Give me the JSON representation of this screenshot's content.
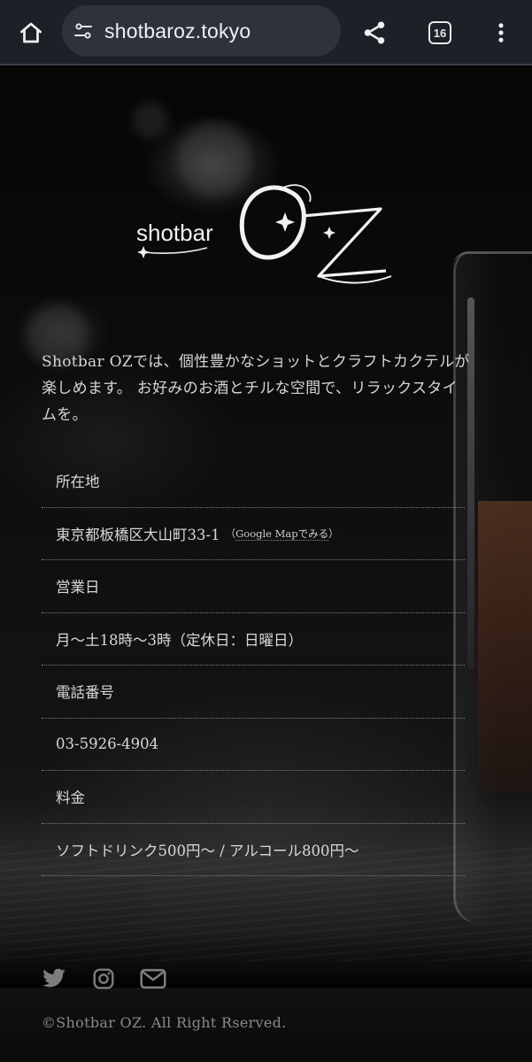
{
  "browser": {
    "url": "shotbaroz.tokyo",
    "tab_count": "16",
    "icons": {
      "home": "home-icon",
      "site_settings": "tune-icon",
      "share": "share-icon",
      "tabs": "tabs-icon",
      "menu": "more-vert-icon"
    }
  },
  "logo": {
    "prefix": "shotbar",
    "name": "OZ"
  },
  "intro": {
    "line1": "Shotbar OZでは、個性豊かなショットとクラフトカクテルが",
    "line2": "楽しめます。 お好みのお酒とチルな空間で、リラックスタイ",
    "line3": "ムを。"
  },
  "info": {
    "location_label": "所在地",
    "address": "東京都板橋区大山町33-1",
    "map_link_open": "（",
    "map_link_label": "Google Mapでみる",
    "map_link_close": "）",
    "hours_label": "営業日",
    "hours": "月〜土18時〜3時（定休日：日曜日）",
    "phone_label": "電話番号",
    "phone": "03-5926-4904",
    "price_label": "料金",
    "price": "ソフトドリンク500円〜 / アルコール800円〜"
  },
  "footer": {
    "social_icons": [
      "twitter-icon",
      "instagram-icon",
      "mail-icon"
    ],
    "copyright": "©Shotbar OZ. All Right Rserved."
  },
  "colors": {
    "browser_bar": "#1d2026",
    "url_pill": "#2e333b",
    "page_background": "#000000",
    "body_text": "#d6d6d6",
    "muted_text": "#8a8a8a",
    "divider": "#7e7e7e"
  }
}
